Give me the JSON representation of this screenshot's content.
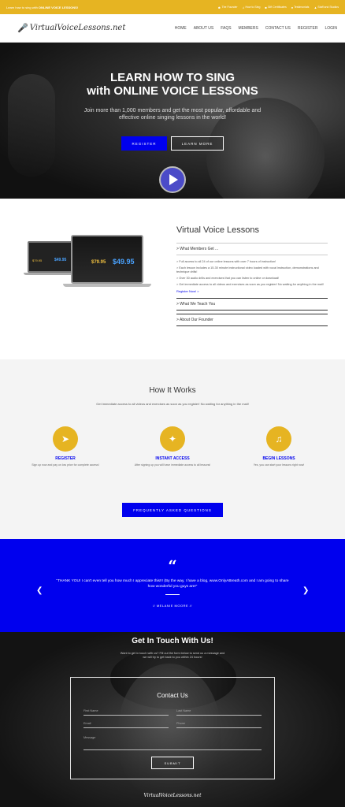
{
  "topbar": {
    "promo_prefix": "Learn how to sing with ",
    "promo_bold": "ONLINE VOICE LESSONS!",
    "links": [
      "The Founder",
      "How to Sing",
      "Gift Certificates",
      "Testimonials",
      "Staff and Studios"
    ]
  },
  "header": {
    "logo": "VirtualVoiceLessons.net",
    "nav": [
      "HOME",
      "ABOUT US",
      "FAQS",
      "MEMBERS",
      "CONTACT US",
      "REGISTER",
      "LOGIN"
    ]
  },
  "hero": {
    "title_line1": "LEARN HOW TO SING",
    "title_line2": "with ONLINE VOICE LESSONS",
    "subtitle": "Join more than 1,000 members and get the most popular, affordable and effective online singing lessons in the world!",
    "register_label": "REGISTER",
    "learn_label": "LEARN MORE"
  },
  "intro": {
    "price_old": "$79.95",
    "price_new": "$49.95",
    "heading": "Virtual Voice Lessons",
    "acc1_title": "> What Members Get ...",
    "bullets": [
      "> Full access to all 24 of our online lessons with over 7 hours of instruction!",
      "> Each lesson includes a 15-30 minute instructional video loaded with vocal instruction, demonstrations and technique drills!",
      "> Over 30 audio drills and exercises that you can listen to online or download!",
      "> Get immediate access to all videos and exercises as soon as you register! No waiting for anything in the mail!"
    ],
    "register_link": "Register Now! >",
    "acc2_title": "> What We Teach You",
    "acc3_title": "> About Our Founder"
  },
  "how": {
    "title": "How It Works",
    "subtitle": "Get immediate access to all videos and exercises as soon as you register! No waiting for anything in the mail!",
    "steps": [
      {
        "title": "REGISTER",
        "desc": "Sign up now and pay on low price for complete access!"
      },
      {
        "title": "INSTANT ACCESS",
        "desc": "After signing up you will have immediate access to all lessons!"
      },
      {
        "title": "BEGIN LESSONS",
        "desc": "Yes, you can start your lessons right now!"
      }
    ],
    "faq_label": "FREQUENTLY ASKED QUESTIONS"
  },
  "testimonial": {
    "quote_mark": "66",
    "text": "\"THANK YOU! I can't even tell you how much I appreciate this!!! (By the way, I have a blog, www.OnlyABreath.com and I am going to share how wonderful you guys are!\"",
    "author": "// MELANIE MOORE //"
  },
  "contact": {
    "title": "Get In Touch With Us!",
    "subtitle": "Want to get in touch with us? Fill out the form below to send us a message and we will try to get back to you within 24 hours!",
    "form_title": "Contact Us",
    "first_name": "First Name",
    "last_name": "Last Name",
    "email": "Email",
    "phone": "Phone",
    "message": "Message",
    "submit_label": "SUBMIT",
    "footer_logo": "VirtualVoiceLessons.net"
  },
  "colors": {
    "accent": "#e6b422",
    "primary_blue": "#0000ee"
  }
}
